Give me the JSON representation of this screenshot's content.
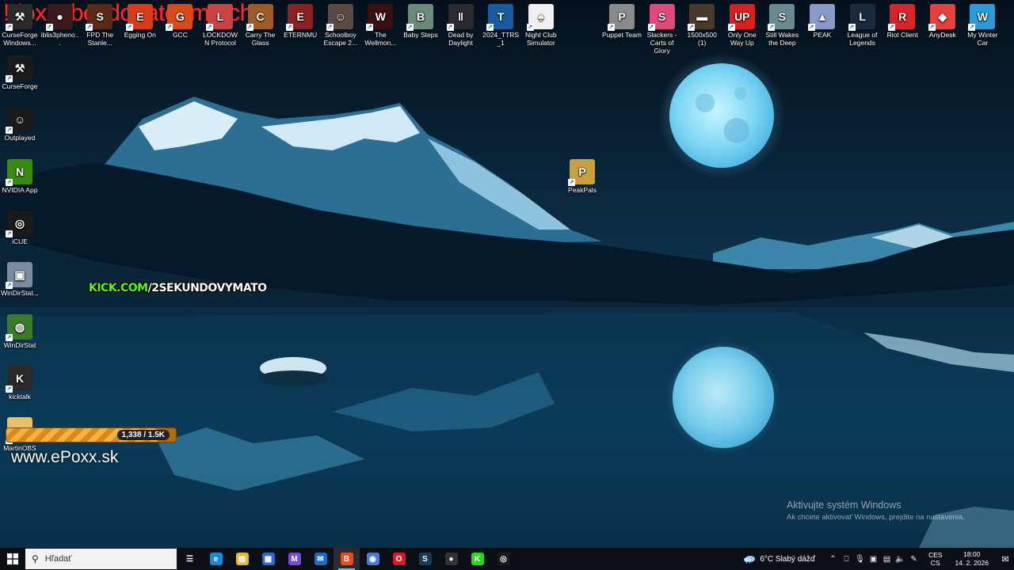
{
  "overlay": {
    "banner": "!doxx !bc !donate !match",
    "kick_prefix": "KICK.COM",
    "kick_suffix": "/2SEKUNDOVYMATO",
    "progress_count": "1,338 / 1.5K",
    "progress_fraction": 0.89,
    "website": "www.ePoxx.sk"
  },
  "desktop_icons_top": [
    {
      "label": "CurseForge Windows...",
      "color": "#2a2a2a",
      "glyph": "⚒",
      "name": "curseforge-windows-icon"
    },
    {
      "label": "iblis3pheno...",
      "color": "#3a1a1a",
      "glyph": "●",
      "name": "iblis-icon"
    },
    {
      "label": "FPD The Stanle...",
      "color": "#5a2a18",
      "glyph": "S",
      "name": "fpd-stanley-icon"
    },
    {
      "label": "Egging On",
      "color": "#d83a1a",
      "glyph": "E",
      "name": "egging-on-icon"
    },
    {
      "label": "GCC",
      "color": "#d84a1a",
      "glyph": "G",
      "name": "gcc-icon"
    },
    {
      "label": "LOCKDOWN Protocol",
      "color": "#c84444",
      "glyph": "L",
      "name": "lockdown-protocol-icon"
    },
    {
      "label": "Carry The Glass",
      "color": "#a05a2a",
      "glyph": "C",
      "name": "carry-the-glass-icon"
    },
    {
      "label": "ETERNMU",
      "color": "#8a2222",
      "glyph": "E",
      "name": "eternmu-icon"
    },
    {
      "label": "Schoolboy Escape 2...",
      "color": "#5a4a44",
      "glyph": "☺",
      "name": "schoolboy-escape-icon"
    },
    {
      "label": "The Wellmon...",
      "color": "#3a1010",
      "glyph": "W",
      "name": "wellmon-icon"
    },
    {
      "label": "Baby Steps",
      "color": "#6a8a7a",
      "glyph": "B",
      "name": "baby-steps-icon"
    },
    {
      "label": "Dead by Daylight",
      "color": "#2a2a30",
      "glyph": "‖",
      "name": "dead-by-daylight-icon"
    },
    {
      "label": "2024_TTRS_1",
      "color": "#1a5aa0",
      "glyph": "T",
      "name": "ttrs-icon"
    },
    {
      "label": "Night Club Simulator",
      "color": "#f0f0f0",
      "glyph": "♠",
      "name": "night-club-simulator-icon"
    }
  ],
  "desktop_icons_top_right": [
    {
      "label": "Puppet Team",
      "color": "#8a8a8a",
      "glyph": "P",
      "name": "puppet-team-icon"
    },
    {
      "label": "Slackers - Carts of Glory",
      "color": "#e04a7a",
      "glyph": "S",
      "name": "slackers-icon"
    },
    {
      "label": "1500x500 (1)",
      "color": "#4a3a2a",
      "glyph": "▬",
      "name": "image-1500x500-icon"
    },
    {
      "label": "Only One Way Up",
      "color": "#d82020",
      "glyph": "UP",
      "name": "only-one-way-up-icon"
    },
    {
      "label": "Still Wakes the Deep",
      "color": "#6a8a90",
      "glyph": "S",
      "name": "still-wakes-the-deep-icon"
    },
    {
      "label": "PEAK",
      "color": "#8a9ac8",
      "glyph": "▲",
      "name": "peak-icon"
    },
    {
      "label": "League of Legends",
      "color": "#1a2a3a",
      "glyph": "L",
      "name": "league-of-legends-icon"
    },
    {
      "label": "Riot Client",
      "color": "#d8242a",
      "glyph": "R",
      "name": "riot-client-icon"
    },
    {
      "label": "AnyDesk",
      "color": "#e8403a",
      "glyph": "◆",
      "name": "anydesk-icon"
    },
    {
      "label": "My Winter Car",
      "color": "#2a9ad8",
      "glyph": "W",
      "name": "my-winter-car-icon"
    }
  ],
  "desktop_icons_left": [
    {
      "label": "CurseForge",
      "color": "#1a1a1a",
      "glyph": "⚒",
      "name": "curseforge-icon"
    },
    {
      "label": "Outplayed",
      "color": "#1a1a1a",
      "glyph": "☺",
      "name": "outplayed-icon"
    },
    {
      "label": "NVIDIA App",
      "color": "#3a8a10",
      "glyph": "N",
      "name": "nvidia-app-icon"
    },
    {
      "label": "iCUE",
      "color": "#1a1a1a",
      "glyph": "◎",
      "name": "icue-icon"
    },
    {
      "label": "WinDirStat...",
      "color": "#7a8aa0",
      "glyph": "▣",
      "name": "windirstat-shortcut-icon"
    },
    {
      "label": "WinDirStat",
      "color": "#3a7a2a",
      "glyph": "◍",
      "name": "windirstat-icon"
    },
    {
      "label": "kicktalk",
      "color": "#2a2a2a",
      "glyph": "K",
      "name": "kicktalk-icon"
    },
    {
      "label": "MartinOBS",
      "color": "#e8c06a",
      "glyph": "▭",
      "name": "martinobs-folder-icon"
    }
  ],
  "desktop_icon_peakpals": {
    "label": "PeakPals",
    "color": "#c8a040",
    "glyph": "P",
    "name": "peakpals-icon"
  },
  "watermark": {
    "line1": "Aktivujte systém Windows",
    "line2": "Ak chcete aktivovať Windows, prejdite na nastavenia."
  },
  "taskbar": {
    "search_placeholder": "Hľadať",
    "apps": [
      {
        "name": "task-view-icon",
        "color": "transparent",
        "glyph": "☰"
      },
      {
        "name": "edge-icon",
        "color": "#1a8ad8",
        "glyph": "e"
      },
      {
        "name": "file-explorer-icon",
        "color": "#e8b830",
        "glyph": "▤"
      },
      {
        "name": "store-icon",
        "color": "#2a6ad8",
        "glyph": "▦"
      },
      {
        "name": "m365-icon",
        "color": "#7a4ad8",
        "glyph": "M"
      },
      {
        "name": "mail-icon",
        "color": "#1a6ac8",
        "glyph": "✉"
      },
      {
        "name": "brave-icon",
        "color": "#f04a1a",
        "glyph": "B",
        "active": true
      },
      {
        "name": "copilot-icon",
        "color": "#4a7ad8",
        "glyph": "◉"
      },
      {
        "name": "opera-icon",
        "color": "#d81a2a",
        "glyph": "O"
      },
      {
        "name": "steam-icon",
        "color": "#1a3a5a",
        "glyph": "S"
      },
      {
        "name": "obs-icon",
        "color": "#333333",
        "glyph": "●"
      },
      {
        "name": "kick-icon",
        "color": "#2ad81a",
        "glyph": "K"
      },
      {
        "name": "outplayed-taskbar-icon",
        "color": "#1a1a1a",
        "glyph": "◎"
      }
    ],
    "weather": "6°C  Slabý dážď",
    "lang_top": "CES",
    "lang_bottom": "CS",
    "time": "18:00",
    "date": "14. 2. 2026"
  }
}
